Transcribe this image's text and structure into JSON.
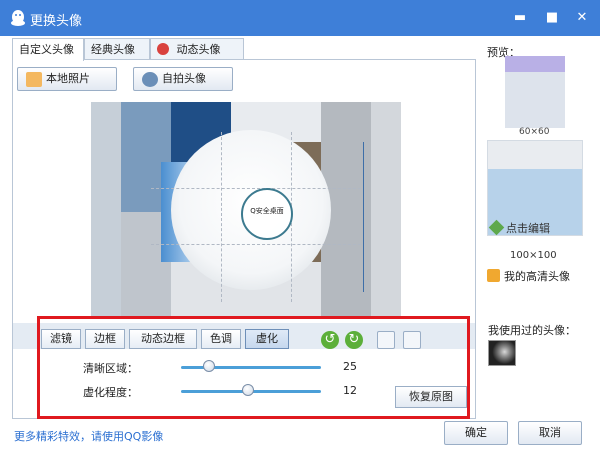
{
  "window": {
    "title": "更换头像",
    "minimize": "▬",
    "maximize": "■",
    "close": "✕"
  },
  "tabs": [
    {
      "label": "自定义头像"
    },
    {
      "label": "经典头像"
    },
    {
      "label": "动态头像"
    }
  ],
  "upload": {
    "local_photo": "本地照片",
    "selfie": "自拍头像"
  },
  "canvas": {
    "focus_text": "Q安全桌面"
  },
  "toolbar": {
    "filter": "滤镜",
    "border": "边框",
    "dynamic_border": "动态边框",
    "tone": "色调",
    "blur": "虚化",
    "rotate_left": "↺",
    "rotate_right": "↻"
  },
  "sliders": {
    "clear_area_label": "清晰区域：",
    "clear_area_value": "25",
    "clear_area_level": 0.2,
    "blur_degree_label": "虚化程度：",
    "blur_degree_value": "12",
    "blur_degree_level": 0.48
  },
  "restore_label": "恢复原图",
  "preview": {
    "label": "预览：",
    "large_size": "60×60",
    "edit_label": "点击编辑",
    "mid_size": "100×100",
    "hd_label": "我的高清头像"
  },
  "history": {
    "label": "我使用过的头像："
  },
  "footer": {
    "promo": "更多精彩特效，请使用QQ影像",
    "ok": "确定",
    "cancel": "取消"
  },
  "colors": {
    "titlebar": "#3e7fd8",
    "highlight": "#e0191f",
    "slider": "#4b9fd8",
    "link": "#2b6fd1"
  }
}
